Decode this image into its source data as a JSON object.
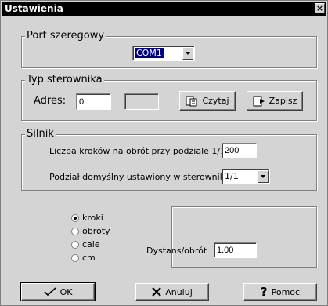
{
  "window": {
    "title": "Ustawienia",
    "close_glyph": "×"
  },
  "port": {
    "legend": "Port szeregowy",
    "selected": "COM1"
  },
  "controller": {
    "legend": "Typ sterownika",
    "address_label": "Adres:",
    "address_value": "0",
    "read_label": "Czytaj",
    "save_label": "Zapisz"
  },
  "motor": {
    "legend": "Silnik",
    "steps_label": "Liczba kroków na obrót przy podziale 1/1:",
    "steps_value": "200",
    "div_label": "Podział domyślny ustawiony w sterowniku:",
    "div_value": "1/1"
  },
  "units": {
    "options": [
      "kroki",
      "obroty",
      "cale",
      "cm"
    ],
    "selected": "kroki",
    "distance_label": "Dystans/obrót",
    "distance_value": "1.00"
  },
  "buttons": {
    "ok": "OK",
    "cancel": "Anuluj",
    "help": "Pomoc"
  },
  "icons": {
    "ok": "checkmark-icon",
    "cancel": "x-icon",
    "help": "question-icon",
    "read": "read-icon",
    "save": "save-icon"
  }
}
